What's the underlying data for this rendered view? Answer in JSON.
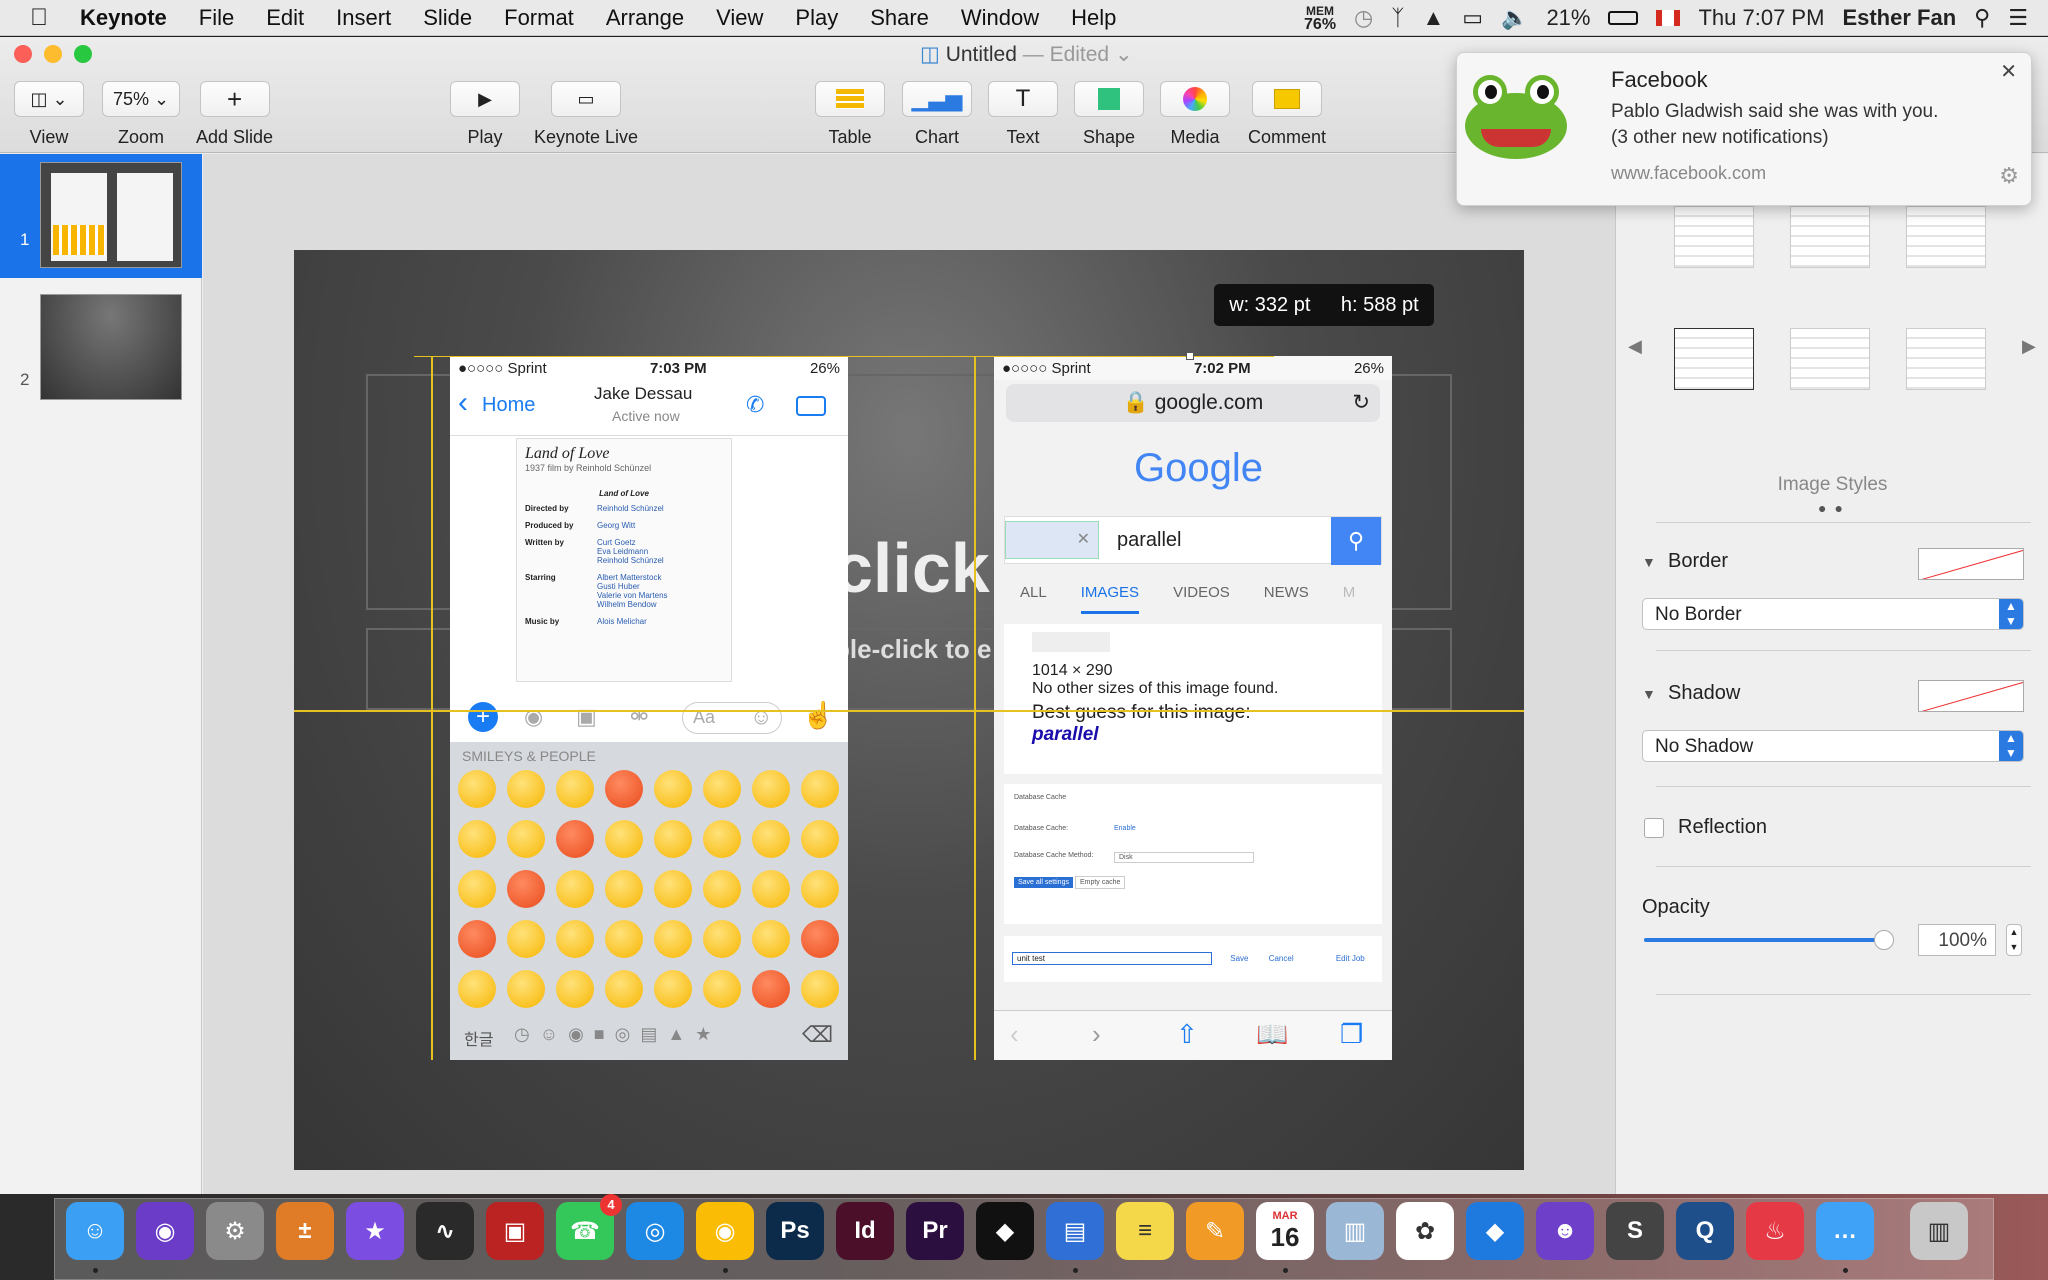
{
  "menubar": {
    "app_name": "Keynote",
    "items": [
      "File",
      "Edit",
      "Insert",
      "Slide",
      "Format",
      "Arrange",
      "View",
      "Play",
      "Share",
      "Window",
      "Help"
    ],
    "mem_label": "MEM",
    "mem_value": "76%",
    "battery": "21%",
    "clock": "Thu 7:07 PM",
    "user": "Esther Fan"
  },
  "window": {
    "title": "Untitled",
    "title_suffix": "— Edited",
    "toolbar": {
      "view": "View",
      "zoom": "Zoom",
      "zoom_value": "75%",
      "add_slide": "Add Slide",
      "play": "Play",
      "keynote_live": "Keynote Live",
      "table": "Table",
      "chart": "Chart",
      "text": "Text",
      "shape": "Shape",
      "media": "Media",
      "comment": "Comment"
    }
  },
  "navigator": {
    "slides": [
      {
        "number": "1",
        "selected": true
      },
      {
        "number": "2",
        "selected": false
      }
    ]
  },
  "canvas": {
    "size_tooltip_w": "w: 332 pt",
    "size_tooltip_h": "h: 588 pt",
    "placeholder_title": "click",
    "placeholder_body": "ble-click to e"
  },
  "messenger": {
    "carrier": "●○○○○ Sprint",
    "time": "7:03 PM",
    "battery": "26%",
    "back_label": "Home",
    "contact_name": "Jake Dessau",
    "contact_status": "Active now",
    "card_title": "Land of Love",
    "card_subtitle": "1937 film by Reinhold Schünzel",
    "table_heading": "Land of Love",
    "rows": [
      {
        "label": "Directed by",
        "value": "Reinhold Schünzel"
      },
      {
        "label": "Produced by",
        "value": "Georg Witt"
      },
      {
        "label": "Written by",
        "value": "Curt Goetz\nEva Leidmann\nReinhold Schünzel"
      },
      {
        "label": "Starring",
        "value": "Albert Matterstock\nGusti Huber\nValerie von Martens\nWilhelm Bendow"
      },
      {
        "label": "Music by",
        "value": "Alois Melichar"
      }
    ],
    "compose_placeholder": "Aa",
    "emoji_section": "SMILEYS & PEOPLE",
    "keyboard_lang": "한글"
  },
  "safari": {
    "carrier": "●○○○○ Sprint",
    "time": "7:02 PM",
    "battery": "26%",
    "url": "google.com",
    "logo": "Google",
    "search_query": "parallel",
    "tabs": [
      "ALL",
      "IMAGES",
      "VIDEOS",
      "NEWS",
      "M"
    ],
    "image_size": "1014 × 290",
    "no_other_sizes": "No other sizes of this image found.",
    "best_guess_label": "Best guess for this image:",
    "best_guess_value": "parallel",
    "settings_fields": [
      "Database Cache",
      "Database Cache:",
      "Database Cache Method:",
      "Save all settings",
      "Empty cache"
    ],
    "enable_label": "Enable",
    "method_value": "Disk",
    "unit_test_value": "unit test",
    "save": "Save",
    "cancel": "Cancel",
    "edit_job": "Edit Job"
  },
  "notification": {
    "app": "Facebook",
    "message": "Pablo Gladwish said she was with you.",
    "detail": "(3 other new notifications)",
    "url": "www.facebook.com"
  },
  "inspector": {
    "image_styles_label": "Image Styles",
    "border_label": "Border",
    "border_value": "No Border",
    "shadow_label": "Shadow",
    "shadow_value": "No Shadow",
    "reflection_label": "Reflection",
    "opacity_label": "Opacity",
    "opacity_value": "100%",
    "opacity_level": 1.0
  },
  "dock": {
    "messages_badge": "4",
    "calendar_month": "MAR",
    "calendar_day": "16"
  },
  "colors": {
    "accent_blue": "#2a7ae2",
    "guide_yellow": "#e6c220",
    "slide_bg": "#3c3c3c",
    "nav_selected": "#1a73e8"
  }
}
